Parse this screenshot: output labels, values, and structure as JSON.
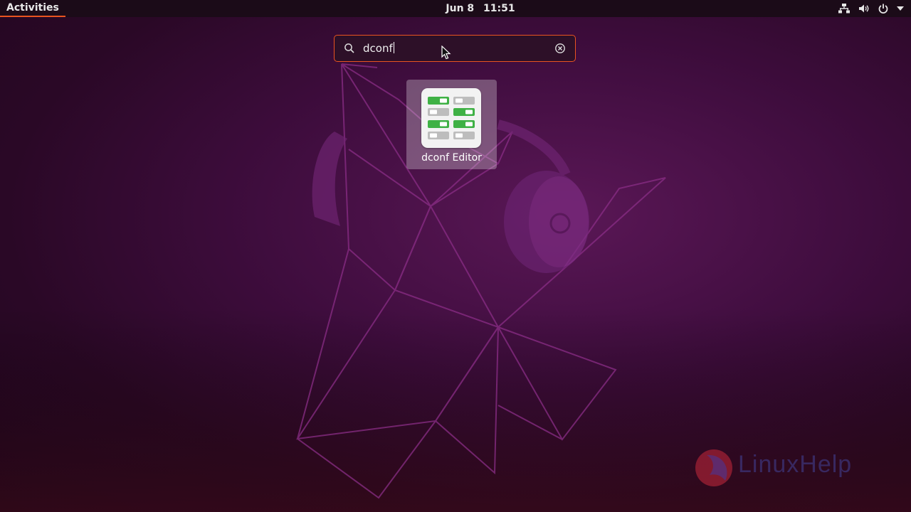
{
  "topbar": {
    "activities_label": "Activities",
    "date": "Jun 8",
    "time": "11:51",
    "tray_icons": [
      "network-icon",
      "volume-icon",
      "power-icon",
      "chevron-down-icon"
    ]
  },
  "search": {
    "value": "dconf",
    "icon": "search-icon",
    "clear_icon": "clear-icon"
  },
  "results": [
    {
      "label": "dconf Editor",
      "icon": "dconf-editor-icon"
    }
  ],
  "watermark": {
    "text": "LinuxHelp"
  },
  "colors": {
    "accent": "#e95420",
    "topbar": "#1b0b18",
    "toggle_on": "#3fb145",
    "toggle_off": "#bdbdbd"
  }
}
